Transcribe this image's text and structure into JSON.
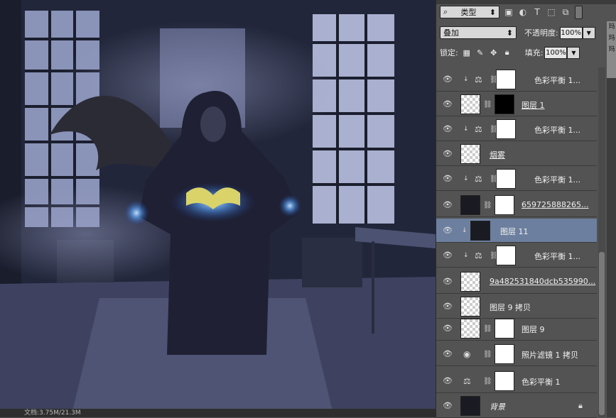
{
  "canvas": {
    "doc_info": "文档:3.75M/21.3M"
  },
  "layers_panel": {
    "filter": {
      "kind": "类型"
    },
    "blend_mode": "叠加",
    "opacity_label": "不透明度:",
    "opacity_value": "100%",
    "lock_label": "锁定:",
    "fill_label": "填充:",
    "fill_value": "100%",
    "side_labels": [
      "玛",
      "玛",
      "玛"
    ],
    "layers": [
      {
        "name": "色彩平衡 1..."
      },
      {
        "name": "图层 1"
      },
      {
        "name": "色彩平衡 1..."
      },
      {
        "name": "烟雾"
      },
      {
        "name": "色彩平衡 1..."
      },
      {
        "name": "659725888265..."
      },
      {
        "name": "图层 11"
      },
      {
        "name": "色彩平衡 1..."
      },
      {
        "name": "9a482531840dcb535990..."
      },
      {
        "name": "图层 9 拷贝"
      },
      {
        "name": "图层 9"
      },
      {
        "name": "照片滤镜 1 拷贝"
      },
      {
        "name": "色彩平衡 1"
      },
      {
        "name": "背景"
      }
    ]
  }
}
